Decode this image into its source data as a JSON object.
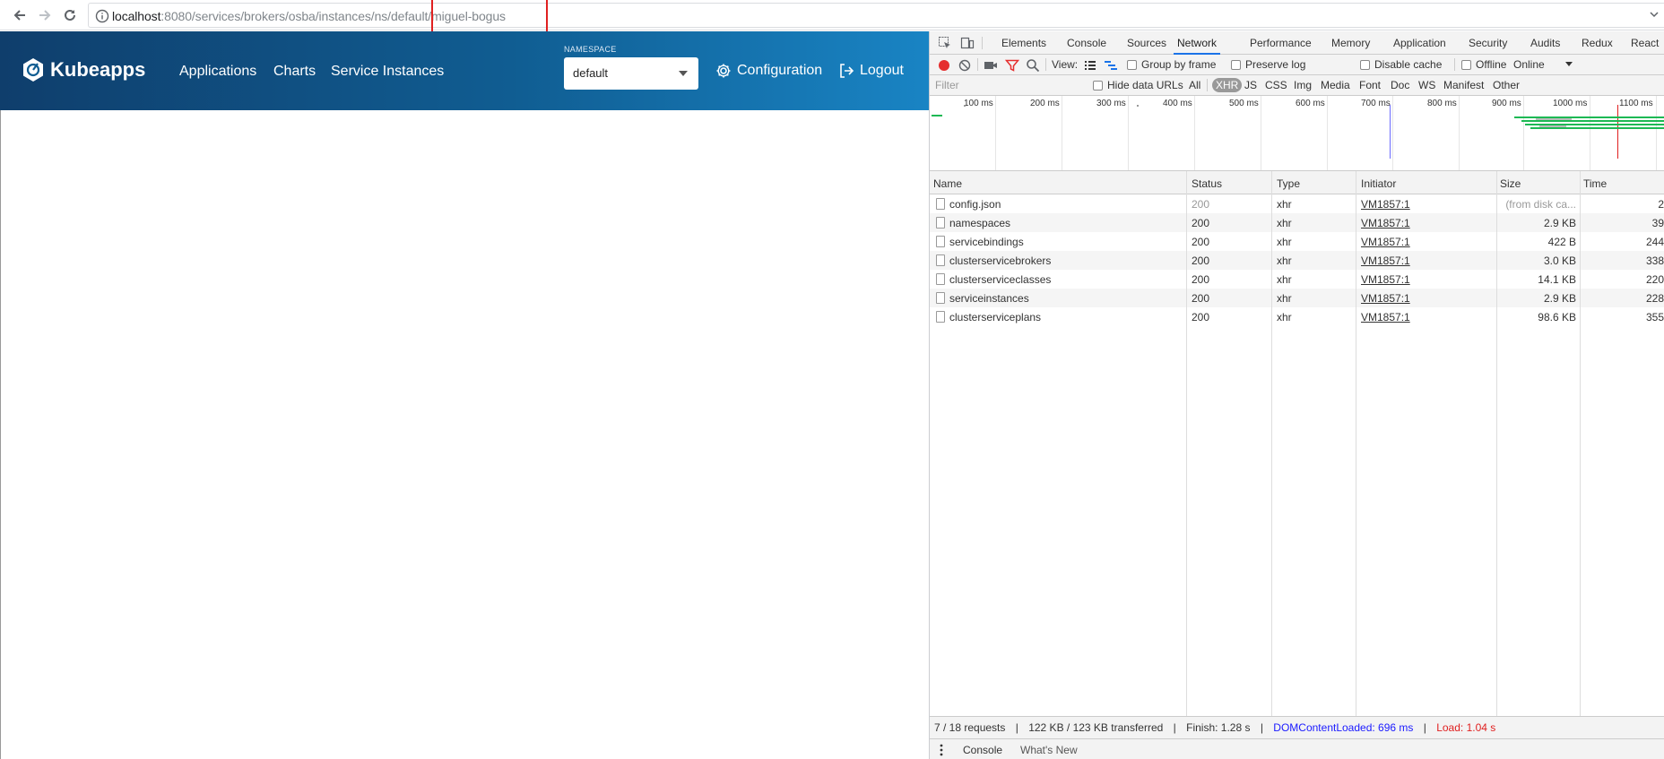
{
  "browser": {
    "url_host": "localhost",
    "url_path": ":8080/services/brokers/osba/instances/ns/default/miguel-bogus"
  },
  "kubeapps": {
    "brand": "Kubeapps",
    "nav": [
      "Applications",
      "Charts",
      "Service Instances"
    ],
    "namespace_label": "NAMESPACE",
    "namespace_value": "default",
    "config_label": "Configuration",
    "logout_label": "Logout"
  },
  "devtools": {
    "tabs": [
      "Elements",
      "Console",
      "Sources",
      "Network",
      "Performance",
      "Memory",
      "Application",
      "Security",
      "Audits",
      "Redux",
      "React"
    ],
    "active_tab": "Network",
    "toolbar": {
      "view_label": "View:",
      "group_by_frame": "Group by frame",
      "preserve_log": "Preserve log",
      "disable_cache": "Disable cache",
      "offline": "Offline",
      "throttle": "Online"
    },
    "filter_placeholder": "Filter",
    "hide_data_urls": "Hide data URLs",
    "filter_types": [
      "All",
      "XHR",
      "JS",
      "CSS",
      "Img",
      "Media",
      "Font",
      "Doc",
      "WS",
      "Manifest",
      "Other"
    ],
    "timeline_labels": [
      "100 ms",
      "200 ms",
      "300 ms",
      "400 ms",
      "500 ms",
      "600 ms",
      "700 ms",
      "800 ms",
      "900 ms",
      "1000 ms",
      "1100 ms"
    ],
    "columns": [
      "Name",
      "Status",
      "Type",
      "Initiator",
      "Size",
      "Time"
    ],
    "rows": [
      {
        "name": "config.json",
        "status": "200",
        "type": "xhr",
        "initiator": "VM1857:1",
        "size": "(from disk ca...",
        "time": "2",
        "dim": true
      },
      {
        "name": "namespaces",
        "status": "200",
        "type": "xhr",
        "initiator": "VM1857:1",
        "size": "2.9 KB",
        "time": "39"
      },
      {
        "name": "servicebindings",
        "status": "200",
        "type": "xhr",
        "initiator": "VM1857:1",
        "size": "422 B",
        "time": "244"
      },
      {
        "name": "clusterservicebrokers",
        "status": "200",
        "type": "xhr",
        "initiator": "VM1857:1",
        "size": "3.0 KB",
        "time": "338"
      },
      {
        "name": "clusterserviceclasses",
        "status": "200",
        "type": "xhr",
        "initiator": "VM1857:1",
        "size": "14.1 KB",
        "time": "220"
      },
      {
        "name": "serviceinstances",
        "status": "200",
        "type": "xhr",
        "initiator": "VM1857:1",
        "size": "2.9 KB",
        "time": "228"
      },
      {
        "name": "clusterserviceplans",
        "status": "200",
        "type": "xhr",
        "initiator": "VM1857:1",
        "size": "98.6 KB",
        "time": "355"
      }
    ],
    "summary": {
      "requests": "7 / 18 requests",
      "transferred": "122 KB / 123 KB transferred",
      "finish": "Finish: 1.28 s",
      "dom_loaded": "DOMContentLoaded: 696 ms",
      "load": "Load: 1.04 s",
      "sep": "|"
    },
    "drawer_tabs": [
      "Console",
      "What's New"
    ],
    "colors": {
      "accent": "#1a73e8",
      "dom_loaded": "#1a1aff",
      "load": "#e02020",
      "record": "#e52e2e"
    }
  }
}
